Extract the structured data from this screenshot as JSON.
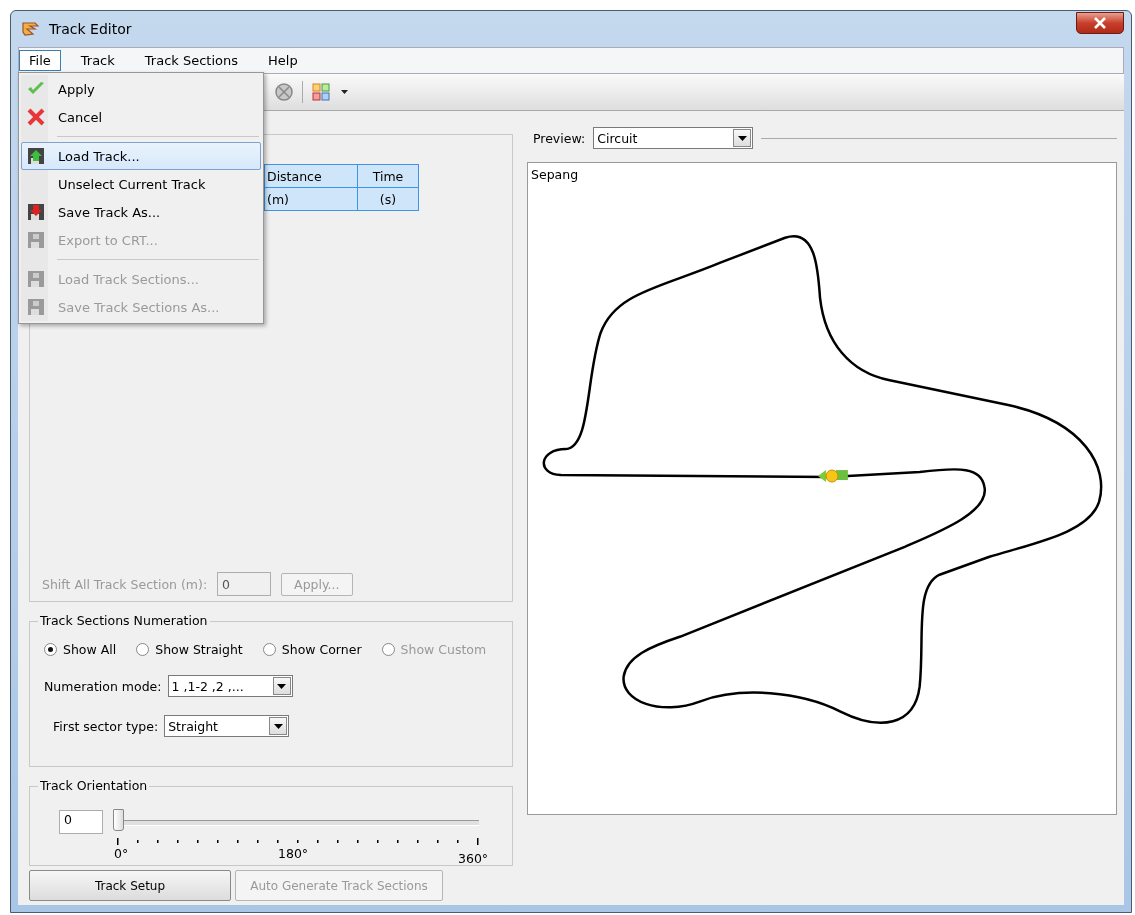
{
  "window": {
    "title": "Track Editor"
  },
  "menu_bar": [
    {
      "label": "File",
      "selected": true
    },
    {
      "label": "Track",
      "selected": false
    },
    {
      "label": "Track Sections",
      "selected": false
    },
    {
      "label": "Help",
      "selected": false
    }
  ],
  "file_menu": [
    {
      "kind": "apply",
      "label": "Apply",
      "disabled": false,
      "selected": false
    },
    {
      "kind": "cancel",
      "label": "Cancel",
      "disabled": false,
      "selected": false
    },
    {
      "kind": "separator"
    },
    {
      "kind": "load",
      "label": "Load Track...",
      "disabled": false,
      "selected": true
    },
    {
      "kind": "plain",
      "label": "Unselect Current Track",
      "disabled": false,
      "selected": false
    },
    {
      "kind": "save",
      "label": "Save Track As...",
      "disabled": false,
      "selected": false
    },
    {
      "kind": "export",
      "label": "Export to CRT...",
      "disabled": true,
      "selected": false
    },
    {
      "kind": "separator"
    },
    {
      "kind": "export",
      "label": "Load Track Sections...",
      "disabled": true,
      "selected": false
    },
    {
      "kind": "export",
      "label": "Save Track Sections As...",
      "disabled": true,
      "selected": false
    }
  ],
  "sections_table": {
    "columns": [
      "Distance",
      "Time"
    ],
    "units": [
      "(m)",
      "(s)"
    ]
  },
  "shift": {
    "label": "Shift All Track Section (m):",
    "value": "0",
    "button": "Apply...",
    "disabled": true
  },
  "numeration": {
    "title": "Track Sections Numeration",
    "options": [
      {
        "label": "Show All",
        "selected": true,
        "disabled": false
      },
      {
        "label": "Show Straight",
        "selected": false,
        "disabled": false
      },
      {
        "label": "Show Corner",
        "selected": false,
        "disabled": false
      },
      {
        "label": "Show Custom",
        "selected": false,
        "disabled": true
      }
    ],
    "mode": {
      "label": "Numeration mode:",
      "value": "1 ,1-2 ,2 ,..."
    },
    "first_sector": {
      "label": "First sector type:",
      "value": "Straight"
    }
  },
  "orientation": {
    "title": "Track Orientation",
    "value": "0",
    "level": 0,
    "tick_labels": [
      "0°",
      "180°",
      "360°"
    ]
  },
  "buttons": [
    {
      "label": "Track Setup",
      "disabled": false
    },
    {
      "label": "Auto Generate Track Sections",
      "disabled": true
    }
  ],
  "preview": {
    "label": "Preview:",
    "value": "Circuit",
    "track_name": "Sepang"
  }
}
